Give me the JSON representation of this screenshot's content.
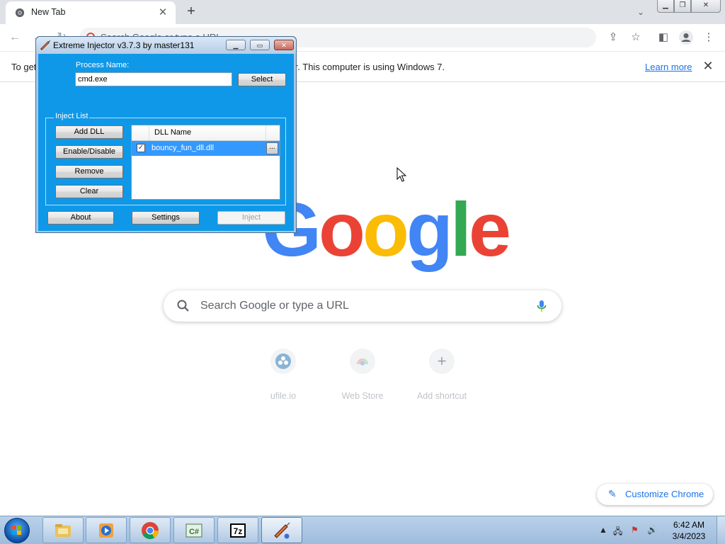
{
  "browser": {
    "tab": {
      "title": "New Tab"
    },
    "omnibox": {
      "placeholder": "Search Google or type a URL"
    },
    "infobar": {
      "message": "To get future Google Chrome updates, you'll need Windows 10 or later. This computer is using Windows 7.",
      "link": "Learn more"
    }
  },
  "ntp": {
    "logo": [
      "G",
      "o",
      "o",
      "g",
      "l",
      "e"
    ],
    "logo_colors": [
      "#4285f4",
      "#ea4335",
      "#fbbc05",
      "#4285f4",
      "#34a853",
      "#ea4335"
    ],
    "search": {
      "placeholder": "Search Google or type a URL"
    },
    "shortcuts": [
      {
        "label": "ufile.io",
        "icon": "ufile-icon"
      },
      {
        "label": "Web Store",
        "icon": "web-store-icon"
      },
      {
        "label": "Add shortcut",
        "icon": "plus-icon"
      }
    ],
    "customize_label": "Customize Chrome"
  },
  "injector": {
    "title": "Extreme Injector v3.7.3 by master131",
    "process_label": "Process Name:",
    "process_value": "cmd.exe",
    "select_label": "Select",
    "group_label": "Inject List",
    "buttons": {
      "add": "Add DLL",
      "toggle": "Enable/Disable",
      "remove": "Remove",
      "clear": "Clear",
      "about": "About",
      "settings": "Settings",
      "inject": "Inject"
    },
    "list": {
      "header": "DLL Name",
      "rows": [
        {
          "name": "bouncy_fun_dll.dll",
          "checked": true,
          "more": "..."
        }
      ]
    }
  },
  "taskbar": {
    "apps": [
      "explorer-icon",
      "media-player-icon",
      "chrome-icon",
      "csharp-icon",
      "7zip-icon",
      "injector-icon"
    ],
    "active_app": "injector-icon",
    "clock": {
      "time": "6:42 AM",
      "date": "3/4/2023"
    }
  },
  "colors": {
    "injector_bg": "#0f98e8",
    "accent_blue": "#1a73e8",
    "selection": "#3399ff"
  }
}
